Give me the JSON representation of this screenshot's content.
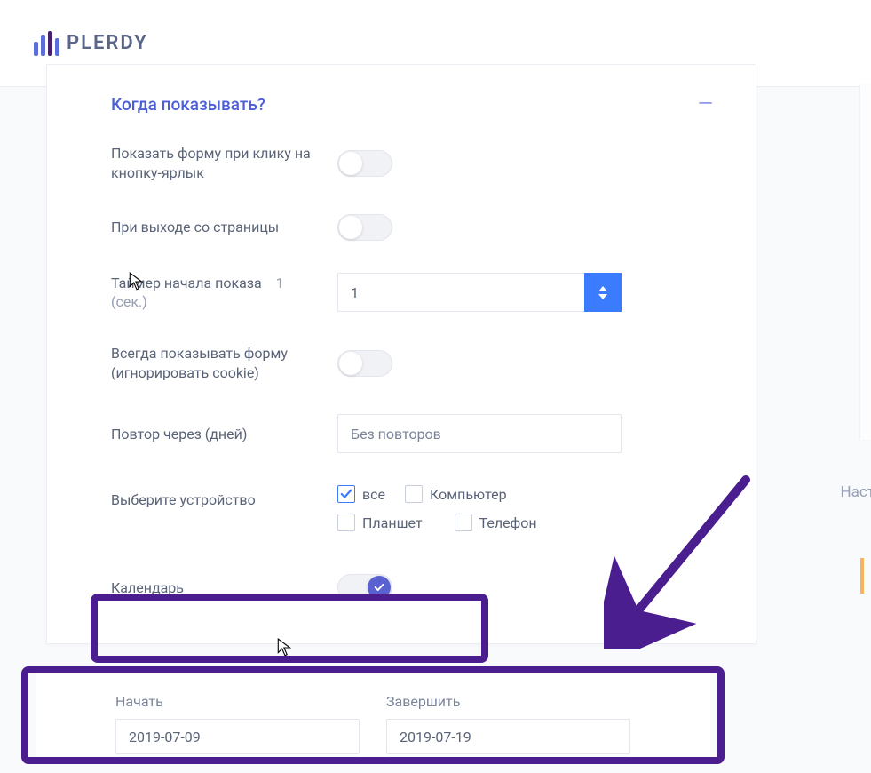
{
  "brand": {
    "name": "PLERDY"
  },
  "section": {
    "title": "Когда показывать?"
  },
  "rows": {
    "showOnClick": {
      "label": "Показать форму при клику на кнопку-ярлык",
      "on": false
    },
    "onExit": {
      "label": "При выходе со страницы",
      "on": false
    },
    "timer": {
      "label": "Таймер начала показа",
      "unit": "1 (сек.)",
      "value": "1"
    },
    "alwaysShow": {
      "label": "Всегда показывать форму (игнорировать cookie)",
      "on": false
    },
    "repeat": {
      "label": "Повтор через (дней)",
      "value": "Без повторов"
    },
    "devices": {
      "label": "Выберите устройство",
      "options": {
        "all": {
          "label": "все",
          "checked": true
        },
        "computer": {
          "label": "Компьютер",
          "checked": false
        },
        "tablet": {
          "label": "Планшет",
          "checked": false
        },
        "phone": {
          "label": "Телефон",
          "checked": false
        }
      }
    },
    "calendar": {
      "label": "Календарь",
      "on": true
    }
  },
  "dates": {
    "start": {
      "label": "Начать",
      "value": "2019-07-09"
    },
    "end": {
      "label": "Завершить",
      "value": "2019-07-19"
    }
  },
  "side": {
    "text": "Наст"
  }
}
